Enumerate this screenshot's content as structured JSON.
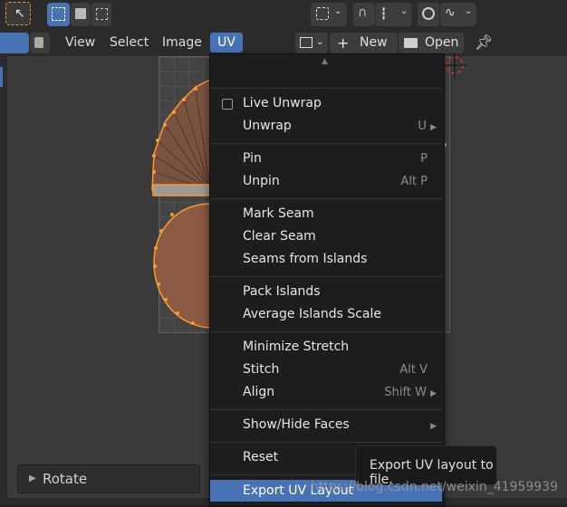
{
  "header": {
    "menus": [
      "View",
      "Select",
      "Image",
      "UV"
    ],
    "new_label": "New",
    "open_label": "Open"
  },
  "uv_menu": {
    "items": [
      {
        "label": "Live Unwrap",
        "shortcut": "",
        "checkbox": true,
        "submenu": false
      },
      {
        "label": "Unwrap",
        "shortcut": "U",
        "submenu": true
      },
      {
        "label": "Pin",
        "shortcut": "P",
        "submenu": false
      },
      {
        "label": "Unpin",
        "shortcut": "Alt P",
        "submenu": false
      },
      {
        "label": "Mark Seam",
        "shortcut": "",
        "submenu": false
      },
      {
        "label": "Clear Seam",
        "shortcut": "",
        "submenu": false
      },
      {
        "label": "Seams from Islands",
        "shortcut": "",
        "submenu": false
      },
      {
        "label": "Pack Islands",
        "shortcut": "",
        "submenu": false
      },
      {
        "label": "Average Islands Scale",
        "shortcut": "",
        "submenu": false
      },
      {
        "label": "Minimize Stretch",
        "shortcut": "",
        "submenu": false
      },
      {
        "label": "Stitch",
        "shortcut": "Alt V",
        "submenu": false
      },
      {
        "label": "Align",
        "shortcut": "Shift W",
        "submenu": true
      },
      {
        "label": "Show/Hide Faces",
        "shortcut": "",
        "submenu": true
      },
      {
        "label": "Reset",
        "shortcut": "",
        "submenu": false
      },
      {
        "label": "Export UV Layout",
        "shortcut": "",
        "submenu": false,
        "highlighted": true
      }
    ]
  },
  "tooltip": {
    "text": "Export UV layout to file."
  },
  "redo_panel": {
    "label": "Rotate"
  },
  "watermark": {
    "text": "https://blog.csdn.net/weixin_41959939"
  },
  "colors": {
    "accent": "#4772b3",
    "island_fill": "#8a5a43",
    "island_edge": "#ff9a2e"
  }
}
